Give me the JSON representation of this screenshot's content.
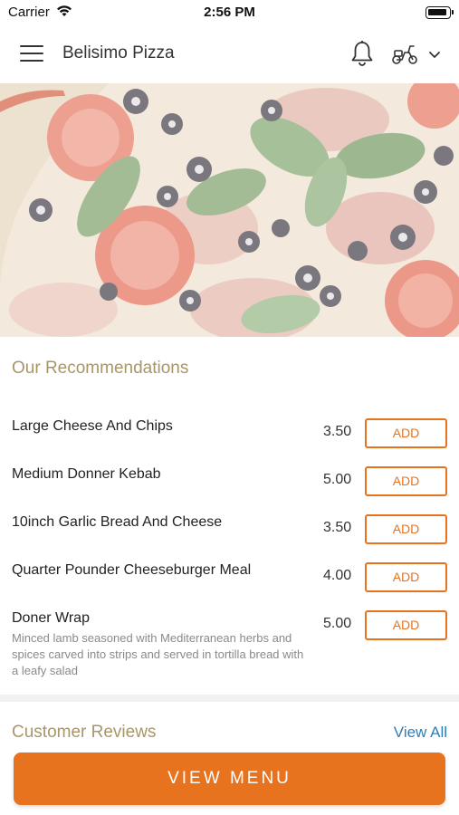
{
  "status_bar": {
    "carrier": "Carrier",
    "time": "2:56 PM"
  },
  "header": {
    "title": "Belisimo Pizza",
    "icons": [
      "menu-icon",
      "bell-icon",
      "scooter-icon",
      "chevron-down-icon"
    ]
  },
  "recommendations": {
    "title": "Our Recommendations",
    "add_label": "ADD",
    "items": [
      {
        "name": "Large Cheese And Chips",
        "price": "3.50",
        "description": ""
      },
      {
        "name": "Medium Donner Kebab",
        "price": "5.00",
        "description": ""
      },
      {
        "name": "10inch Garlic Bread And Cheese",
        "price": "3.50",
        "description": ""
      },
      {
        "name": "Quarter Pounder Cheeseburger Meal",
        "price": "4.00",
        "description": ""
      },
      {
        "name": "Doner Wrap",
        "price": "5.00",
        "description": "Minced lamb seasoned with Mediterranean herbs and spices carved into strips and served in tortilla bread with a leafy salad"
      }
    ]
  },
  "reviews": {
    "title": "Customer Reviews",
    "view_all": "View All"
  },
  "footer": {
    "view_menu": "VIEW MENU"
  },
  "colors": {
    "accent": "#e8731e",
    "section_title": "#a89668",
    "link": "#2b7fb8"
  }
}
